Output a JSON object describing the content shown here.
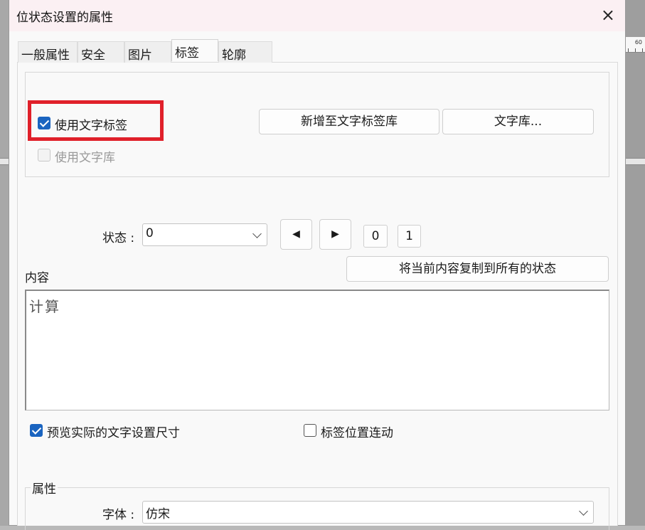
{
  "dialog": {
    "title": "位状态设置的属性",
    "close_icon": "×"
  },
  "tabs": [
    {
      "label": "一般属性",
      "active": false
    },
    {
      "label": "安全",
      "active": false
    },
    {
      "label": "图片",
      "active": false
    },
    {
      "label": "标签",
      "active": true
    },
    {
      "label": "轮廓",
      "active": false
    }
  ],
  "text_label": {
    "use_text_label": "使用文字标签",
    "use_text_label_checked": true,
    "use_text_library": "使用文字库",
    "use_text_library_checked": false,
    "use_text_library_enabled": false,
    "add_to_library_button": "新增至文字标签库",
    "library_button": "文字库..."
  },
  "state": {
    "label": "状态 :",
    "value": "0",
    "prev_icon": "◀",
    "next_icon": "▶",
    "state_0": "0",
    "state_1": "1",
    "copy_button": "将当前内容复制到所有的状态"
  },
  "content": {
    "label": "内容",
    "value": "计算"
  },
  "options": {
    "preview_actual_size": "预览实际的文字设置尺寸",
    "preview_actual_size_checked": true,
    "label_position_link": "标签位置连动",
    "label_position_link_checked": false
  },
  "attributes": {
    "group_title": "属性",
    "font_label": "字体 :",
    "font_value": "仿宋"
  },
  "background": {
    "ruler_text": "60"
  },
  "colors": {
    "accent": "#1a64c0",
    "highlight_box": "#e0202a",
    "titlebar": "#fbf0f3"
  }
}
